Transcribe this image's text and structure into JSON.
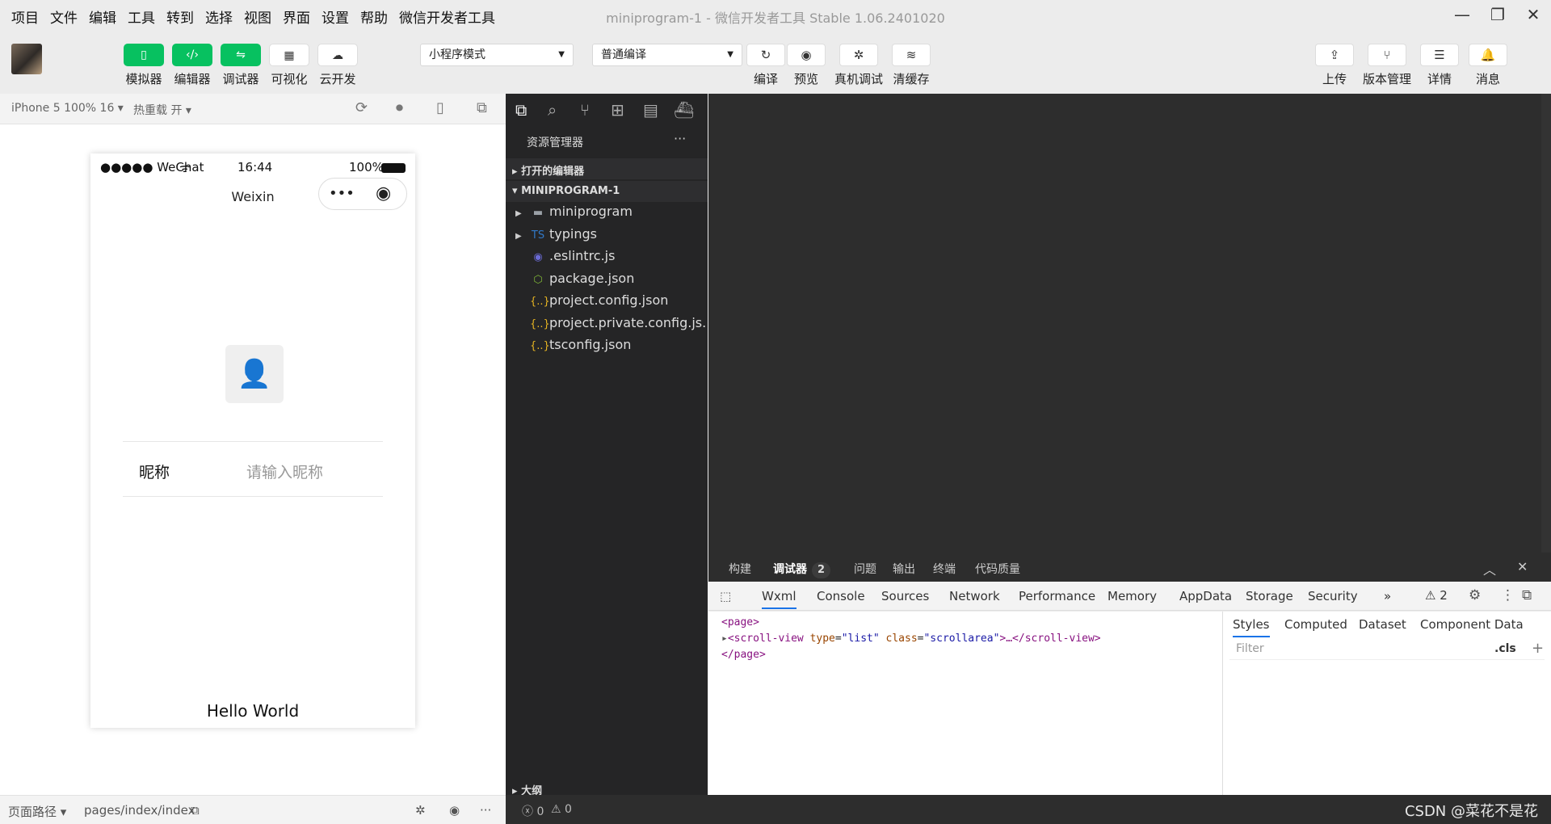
{
  "menu": [
    "项目",
    "文件",
    "编辑",
    "工具",
    "转到",
    "选择",
    "视图",
    "界面",
    "设置",
    "帮助",
    "微信开发者工具"
  ],
  "window": {
    "title": "miniprogram-1 - 微信开发者工具 Stable 1.06.2401020",
    "min": "—",
    "max": "❐",
    "close": "✕"
  },
  "toolbar": {
    "simulator": "模拟器",
    "editor": "编辑器",
    "debugger": "调试器",
    "visual": "可视化",
    "cloud": "云开发",
    "mode_select": "小程序模式",
    "compile_select": "普通编译",
    "compile": "编译",
    "preview": "预览",
    "remote_debug": "真机调试",
    "clear_cache": "清缓存",
    "upload": "上传",
    "version": "版本管理",
    "details": "详情",
    "messages": "消息",
    "sim_icon": "▯",
    "editor_icon": "‹/›",
    "debug_icon": "⇋",
    "visual_icon": "▦",
    "cloud_icon": "☁",
    "compile_icon": "↻",
    "preview_icon": "◉",
    "remote_icon": "✲",
    "cache_icon": "≋",
    "upload_icon": "⇪",
    "version_icon": "⑂",
    "details_icon": "☰",
    "messages_icon": "🔔"
  },
  "simbar": {
    "device": "iPhone 5 100% 16 ▾",
    "hot_reload": "热重载 开 ▾"
  },
  "phone": {
    "signal": "●●●●● WeChat",
    "wifi": "ᯤ",
    "time": "16:44",
    "battery": "100%",
    "nav_title": "Weixin",
    "capsule_dots": "•••",
    "capsule_target": "◉",
    "nickname_label": "昵称",
    "nickname_placeholder": "请输入昵称",
    "hello": "Hello World",
    "avatar_glyph": "👤"
  },
  "simfooter": {
    "path_label": "页面路径 ▾",
    "path": "pages/index/index",
    "copy_icon": "⧉",
    "bug_icon": "✲",
    "eye_icon": "◉",
    "more_icon": "···"
  },
  "explorer": {
    "title": "资源管理器",
    "more": "···",
    "open_editors": "打开的编辑器",
    "project": "MINIPROGRAM-1",
    "outline": "大纲",
    "items": [
      {
        "name": "miniprogram",
        "icon": "▬",
        "color": "#9aa0a6",
        "arrow": "▶"
      },
      {
        "name": "typings",
        "icon": "TS",
        "color": "#3178c6",
        "arrow": "▶"
      },
      {
        "name": ".eslintrc.js",
        "icon": "◉",
        "color": "#6b6bd6",
        "arrow": ""
      },
      {
        "name": "package.json",
        "icon": "⬡",
        "color": "#7fb636",
        "arrow": ""
      },
      {
        "name": "project.config.json",
        "icon": "{..}",
        "color": "#e6b422",
        "arrow": ""
      },
      {
        "name": "project.private.config.js...",
        "icon": "{..}",
        "color": "#e6b422",
        "arrow": ""
      },
      {
        "name": "tsconfig.json",
        "icon": "{..}",
        "color": "#e6b422",
        "arrow": ""
      }
    ]
  },
  "debug": {
    "tabs": [
      "构建",
      "调试器",
      "问题",
      "输出",
      "终端",
      "代码质量"
    ],
    "debugger_badge": "2",
    "devtools_tabs": [
      "Wxml",
      "Console",
      "Sources",
      "Network",
      "Performance",
      "Memory",
      "AppData",
      "Storage",
      "Security"
    ],
    "more_tabs": "»",
    "warnings": "⚠ 2",
    "wxml": {
      "page_open": "<page>",
      "sv_open": "<scroll-view",
      "attr_type": "type",
      "val_type": "\"list\"",
      "attr_class": "class",
      "val_class": "\"scrollarea\"",
      "sv_close": ">…</scroll-view>",
      "page_close": "</page>"
    },
    "styles_tabs": [
      "Styles",
      "Computed",
      "Dataset",
      "Component Data"
    ],
    "filter_placeholder": "Filter",
    "cls": ".cls",
    "plus": "+"
  },
  "status": {
    "errors": "ⓧ 0",
    "warnings": "⚠ 0"
  },
  "watermark": "CSDN @菜花不是花"
}
